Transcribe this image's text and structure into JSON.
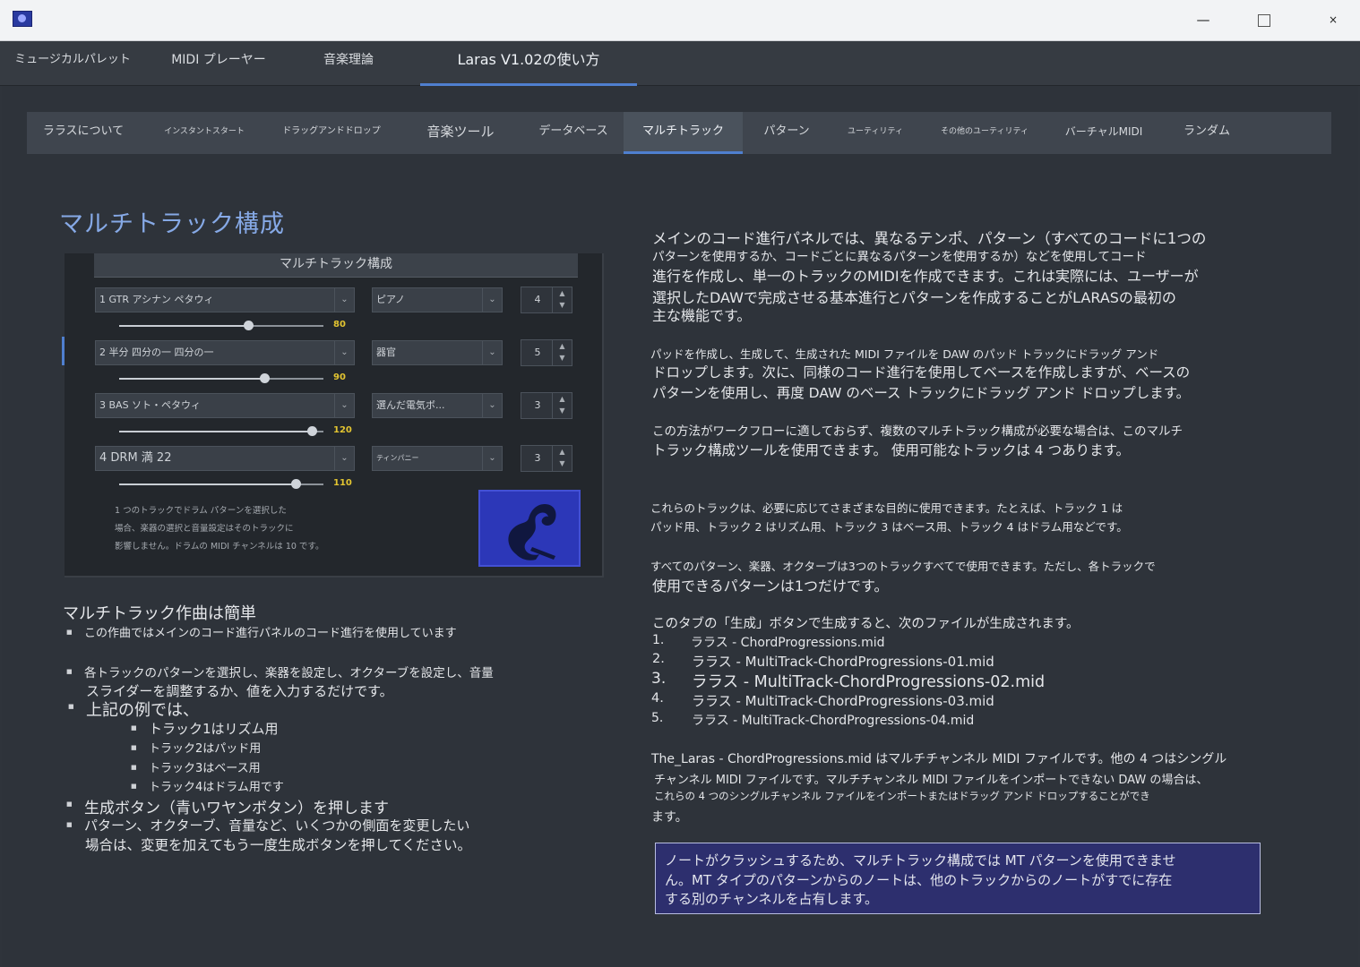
{
  "window": {
    "minimize": "—",
    "close": "×"
  },
  "main_tabs": [
    "ミュージカルパレット",
    "MIDI プレーヤー",
    "音楽理論",
    "Laras V1.02の使い方"
  ],
  "sub_tabs": [
    "ララスについて",
    "インスタントスタート",
    "ドラッグアンドドロップ",
    "音楽ツール",
    "データベース",
    "マルチトラック",
    "パターン",
    "ユーティリティ",
    "その他のユーティリティ",
    "バーチャルMIDI",
    "ランダム"
  ],
  "page_title": "マルチトラック構成",
  "panel": {
    "header": "マルチトラック構成",
    "tracks": [
      {
        "pattern": "1 GTR アシナン ペタウィ",
        "instrument": "ピアノ",
        "octave": "4",
        "volume": 80,
        "volume_label": "80"
      },
      {
        "pattern": "2 半分 四分の一 四分の一",
        "instrument": "器官",
        "octave": "5",
        "volume": 90,
        "volume_label": "90"
      },
      {
        "pattern": "3 BAS ソト・ペタウィ",
        "instrument": "選んだ電気ボ...",
        "octave": "3",
        "volume": 120,
        "volume_label": "120"
      },
      {
        "pattern": "4 DRM 満 22",
        "instrument": "ティンパニー",
        "octave": "3",
        "volume": 110,
        "volume_label": "110"
      }
    ],
    "note": [
      "1 つのトラックでドラム パターンを選択した",
      "場合、楽器の選択と音量設定はそのトラックに",
      "影響しません。ドラムの MIDI チャンネルは 10 です。"
    ],
    "arrow_icon": "chevron-down-icon",
    "spin_icon": "up-down-stepper-icon",
    "generate_icon": "laras-logo-icon"
  },
  "left": {
    "heading": "マルチトラック作曲は簡単",
    "bullets": [
      "この作曲ではメインのコード進行パネルのコード進行を使用しています",
      "各トラックのパターンを選択し、楽器を設定し、オクターブを設定し、音量",
      "スライダーを調整するか、値を入力するだけです。",
      "上記の例では、",
      "トラック1はリズム用",
      "トラック2はパッド用",
      "トラック3はベース用",
      "トラック4はドラム用です",
      "生成ボタン（青いワヤンボタン）を押します",
      "パターン、オクターブ、音量など、いくつかの側面を変更したい",
      "場合は、変更を加えてもう一度生成ボタンを押してください。"
    ]
  },
  "right": {
    "p1": [
      "メインのコード進行パネルでは、異なるテンポ、パターン（すべてのコードに1つの",
      "パターンを使用するか、コードごとに異なるパターンを使用するか）などを使用してコード",
      "進行を作成し、単一のトラックのMIDIを作成できます。これは実際には、ユーザーが",
      "選択したDAWで完成させる基本進行とパターンを作成することがLARASの最初の",
      "主な機能です。"
    ],
    "p2": [
      "パッドを作成し、生成して、生成された MIDI ファイルを DAW のパッド トラックにドラッグ アンド",
      "ドロップします。次に、同様のコード進行を使用してベースを作成しますが、ベースの",
      "パターンを使用し、再度 DAW のベース トラックにドラッグ アンド ドロップします。"
    ],
    "p3": [
      "この方法がワークフローに適しておらず、複数のマルチトラック構成が必要な場合は、このマルチ",
      "トラック構成ツールを使用できます。 使用可能なトラックは 4 つあります。"
    ],
    "p4": [
      "これらのトラックは、必要に応じてさまざまな目的に使用できます。たとえば、トラック 1 は",
      "パッド用、トラック 2 はリズム用、トラック 3 はベース用、トラック 4 はドラム用などです。"
    ],
    "p5": [
      "すべてのパターン、楽器、オクターブは3つのトラックすべてで使用できます。ただし、各トラックで",
      "使用できるパターンは1つだけです。"
    ],
    "p6": "このタブの「生成」ボタンで生成すると、次のファイルが生成されます。",
    "files": [
      {
        "n": "1.",
        "name": "ララス - ChordProgressions.mid"
      },
      {
        "n": "2.",
        "name": "ララス - MultiTrack-ChordProgressions-01.mid"
      },
      {
        "n": "3.",
        "name": "ララス - MultiTrack-ChordProgressions-02.mid"
      },
      {
        "n": "4.",
        "name": "ララス - MultiTrack-ChordProgressions-03.mid"
      },
      {
        "n": "5.",
        "name": "ララス - MultiTrack-ChordProgressions-04.mid"
      }
    ],
    "p7": [
      "The_Laras - ChordProgressions.mid はマルチチャンネル MIDI ファイルです。他の 4 つはシングル",
      "チャンネル MIDI ファイルです。マルチチャンネル MIDI ファイルをインポートできない DAW の場合は、",
      "これらの 4 つのシングルチャンネル ファイルをインポートまたはドラッグ アンド ドロップすることができ",
      "ます。"
    ],
    "warning": [
      "ノートがクラッシュするため、マルチトラック構成では MT パターンを使用できませ",
      "ん。MT タイプのパターンからのノートは、他のトラックからのノートがすでに存在",
      "する別のチャンネルを占有します。"
    ]
  }
}
